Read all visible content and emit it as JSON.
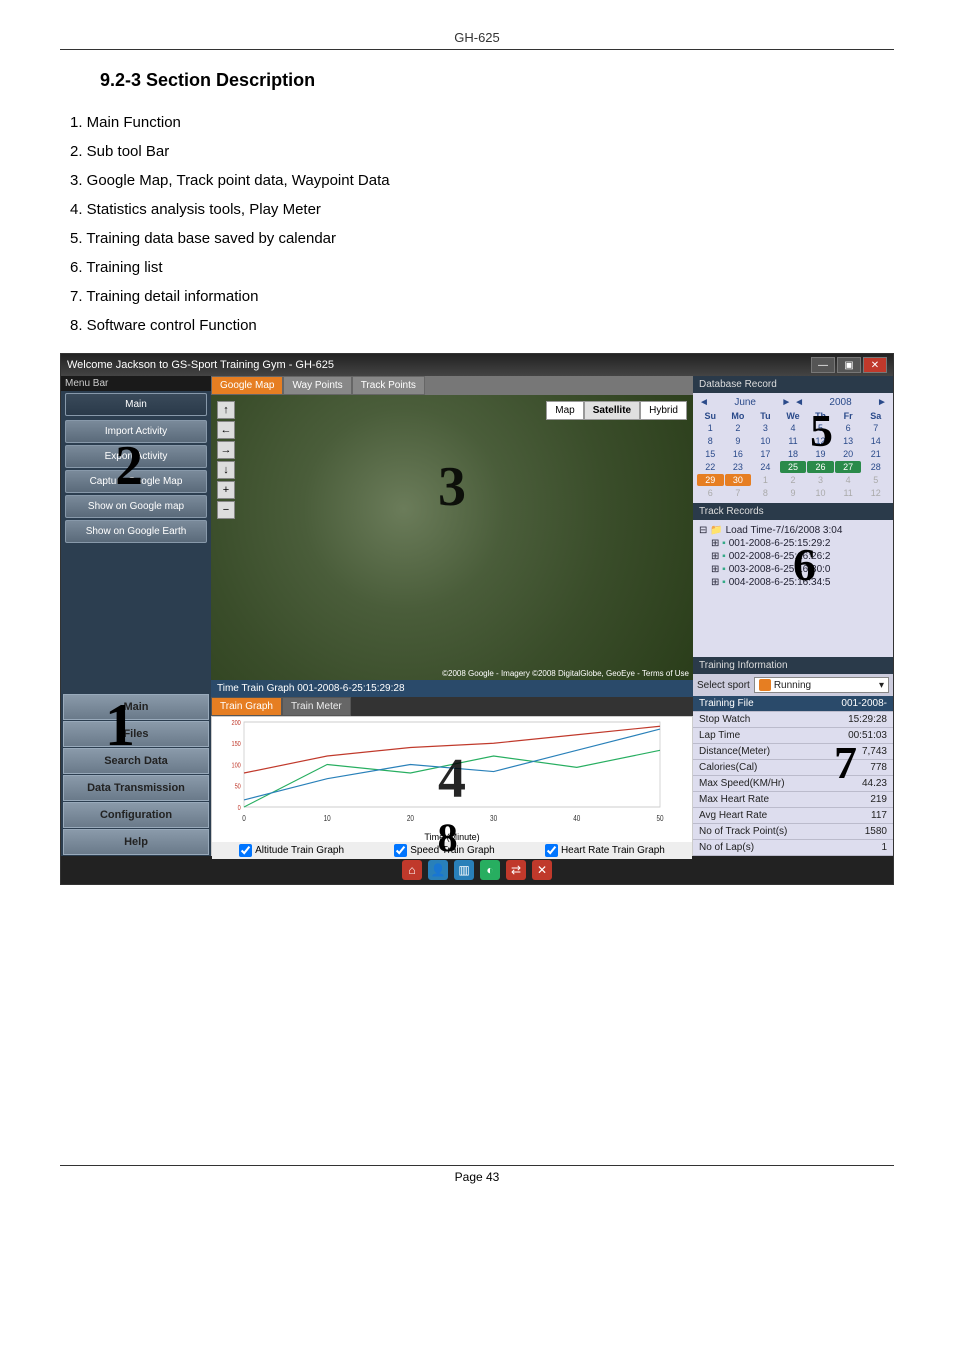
{
  "doc": {
    "header": "GH-625",
    "section_title": "9.2-3 Section Description",
    "list": [
      "Main Function",
      "Sub tool Bar",
      "Google Map, Track point data, Waypoint Data",
      "Statistics analysis tools, Play Meter",
      "Training data base saved by calendar",
      "Training list",
      "Training detail information",
      "Software control Function"
    ],
    "footer": "Page 43"
  },
  "app": {
    "title": "Welcome Jackson to GS-Sport Training Gym - GH-625",
    "win_controls": {
      "min": "—",
      "max": "▣",
      "close": "✕"
    },
    "menu_bar_label": "Menu Bar",
    "sidebar_top": {
      "header": "Main",
      "items": [
        "Import Activity",
        "Export Activity",
        "Capture Google Map",
        "Show on Google map",
        "Show on Google Earth"
      ]
    },
    "sidebar_bottom": [
      "Main",
      "Files",
      "Search Data",
      "Data Transmission",
      "Configuration",
      "Help"
    ],
    "map": {
      "tabs": [
        "Google Map",
        "Way Points",
        "Track Points"
      ],
      "type_buttons": [
        "Map",
        "Satellite",
        "Hybrid"
      ],
      "active_type": "Satellite",
      "zoom_controls": [
        "↑",
        "←",
        "→",
        "↓",
        "+",
        "−"
      ],
      "attribution": "©2008 Google - Imagery ©2008 DigitalGlobe, GeoEye - Terms of Use"
    },
    "graph": {
      "header": "Time Train Graph 001-2008-6-25:15:29:28",
      "tabs": [
        "Train Graph",
        "Train Meter"
      ],
      "xlabel": "Time (Minute)",
      "checkboxes": [
        "Altitude Train Graph",
        "Speed Train Graph",
        "Heart Rate Train Graph"
      ]
    },
    "right": {
      "db_header": "Database Record",
      "calendar": {
        "month": "June",
        "year": "2008",
        "dow": [
          "Su",
          "Mo",
          "Tu",
          "We",
          "Th",
          "Fr",
          "Sa"
        ],
        "days": [
          {
            "n": "1",
            "cls": ""
          },
          {
            "n": "2",
            "cls": ""
          },
          {
            "n": "3",
            "cls": ""
          },
          {
            "n": "4",
            "cls": ""
          },
          {
            "n": "5",
            "cls": ""
          },
          {
            "n": "6",
            "cls": ""
          },
          {
            "n": "7",
            "cls": ""
          },
          {
            "n": "8",
            "cls": ""
          },
          {
            "n": "9",
            "cls": ""
          },
          {
            "n": "10",
            "cls": ""
          },
          {
            "n": "11",
            "cls": ""
          },
          {
            "n": "12",
            "cls": ""
          },
          {
            "n": "13",
            "cls": ""
          },
          {
            "n": "14",
            "cls": ""
          },
          {
            "n": "15",
            "cls": ""
          },
          {
            "n": "16",
            "cls": ""
          },
          {
            "n": "17",
            "cls": ""
          },
          {
            "n": "18",
            "cls": ""
          },
          {
            "n": "19",
            "cls": ""
          },
          {
            "n": "20",
            "cls": ""
          },
          {
            "n": "21",
            "cls": ""
          },
          {
            "n": "22",
            "cls": ""
          },
          {
            "n": "23",
            "cls": ""
          },
          {
            "n": "24",
            "cls": ""
          },
          {
            "n": "25",
            "cls": "hl"
          },
          {
            "n": "26",
            "cls": "hl"
          },
          {
            "n": "27",
            "cls": "hl"
          },
          {
            "n": "28",
            "cls": ""
          },
          {
            "n": "29",
            "cls": "sel"
          },
          {
            "n": "30",
            "cls": "sel"
          },
          {
            "n": "1",
            "cls": "other"
          },
          {
            "n": "2",
            "cls": "other"
          },
          {
            "n": "3",
            "cls": "other"
          },
          {
            "n": "4",
            "cls": "other"
          },
          {
            "n": "5",
            "cls": "other"
          },
          {
            "n": "6",
            "cls": "other"
          },
          {
            "n": "7",
            "cls": "other"
          },
          {
            "n": "8",
            "cls": "other"
          },
          {
            "n": "9",
            "cls": "other"
          },
          {
            "n": "10",
            "cls": "other"
          },
          {
            "n": "11",
            "cls": "other"
          },
          {
            "n": "12",
            "cls": "other"
          }
        ]
      },
      "track_header": "Track Records",
      "tree_root": "Load Time-7/16/2008 3:04",
      "tree_items": [
        "001-2008-6-25:15:29:2",
        "002-2008-6-25:16:26:2",
        "003-2008-6-25:16:30:0",
        "004-2008-6-25:16:34:5"
      ],
      "train_info_header": "Training Information",
      "select_sport_label": "Select sport",
      "sport_value": "Running",
      "info_rows": [
        {
          "k": "Training File",
          "v": "001-2008-"
        },
        {
          "k": "Stop Watch",
          "v": "15:29:28"
        },
        {
          "k": "Lap Time",
          "v": "00:51:03"
        },
        {
          "k": "Distance(Meter)",
          "v": "7,743"
        },
        {
          "k": "Calories(Cal)",
          "v": "778"
        },
        {
          "k": "Max Speed(KM/Hr)",
          "v": "44.23"
        },
        {
          "k": "Max Heart Rate",
          "v": "219"
        },
        {
          "k": "Avg Heart Rate",
          "v": "117"
        },
        {
          "k": "No of Track Point(s)",
          "v": "1580"
        },
        {
          "k": "No of Lap(s)",
          "v": "1"
        }
      ]
    },
    "status_icons": [
      {
        "bg": "#c0392b",
        "txt": "⌂"
      },
      {
        "bg": "#2980b9",
        "txt": "👤"
      },
      {
        "bg": "#2980b9",
        "txt": "▥"
      },
      {
        "bg": "#27ae60",
        "txt": "◐"
      },
      {
        "bg": "#c0392b",
        "txt": "⇄"
      },
      {
        "bg": "#c0392b",
        "txt": "✕"
      }
    ]
  },
  "chart_data": {
    "type": "line",
    "xlabel": "Time (Minute)",
    "x": [
      0,
      10,
      20,
      30,
      40,
      50
    ],
    "series": [
      {
        "name": "Heart Rate (bpm)",
        "color": "#c0392b",
        "ylim": [
          0,
          200
        ],
        "values": [
          80,
          120,
          140,
          150,
          170,
          190
        ]
      },
      {
        "name": "Speed",
        "color": "#27ae60",
        "ylim": [
          0,
          30
        ],
        "values": [
          0,
          15,
          12,
          18,
          14,
          20
        ]
      },
      {
        "name": "Altitude (Meter)",
        "color": "#2980b9",
        "ylim": [
          0,
          60
        ],
        "values": [
          5,
          20,
          30,
          25,
          40,
          55
        ]
      }
    ]
  }
}
